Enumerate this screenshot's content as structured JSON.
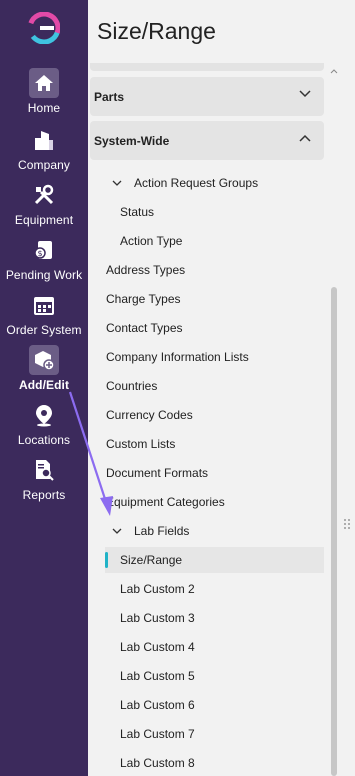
{
  "colors": {
    "sidebar_bg": "#3c2a5c",
    "accent": "#21b3c7",
    "arrow": "#8c6cf0"
  },
  "sidebar": {
    "items": [
      {
        "label": "Home",
        "icon": "home-icon",
        "active": false
      },
      {
        "label": "Company",
        "icon": "building-icon",
        "active": false
      },
      {
        "label": "Equipment",
        "icon": "tools-icon",
        "active": false
      },
      {
        "label": "Pending Work",
        "icon": "money-icon",
        "active": false
      },
      {
        "label": "Order System",
        "icon": "calendar-icon",
        "active": false
      },
      {
        "label": "Add/Edit",
        "icon": "add-box-icon",
        "active": true
      },
      {
        "label": "Locations",
        "icon": "location-pin-icon",
        "active": false
      },
      {
        "label": "Reports",
        "icon": "report-search-icon",
        "active": false
      }
    ]
  },
  "main": {
    "title": "Size/Range",
    "sections": [
      {
        "label": "Parts",
        "expanded": false
      },
      {
        "label": "System-Wide",
        "expanded": true
      }
    ],
    "tree": [
      "Action Request Groups",
      "Status",
      "Action Type",
      "Address Types",
      "Charge Types",
      "Contact Types",
      "Company Information Lists",
      "Countries",
      "Currency Codes",
      "Custom Lists",
      "Document Formats",
      "Equipment Categories",
      "Lab Fields",
      "Size/Range",
      "Lab Custom 2",
      "Lab Custom 3",
      "Lab Custom 4",
      "Lab Custom 5",
      "Lab Custom 6",
      "Lab Custom 7",
      "Lab Custom 8"
    ],
    "selected_item": "Size/Range"
  }
}
